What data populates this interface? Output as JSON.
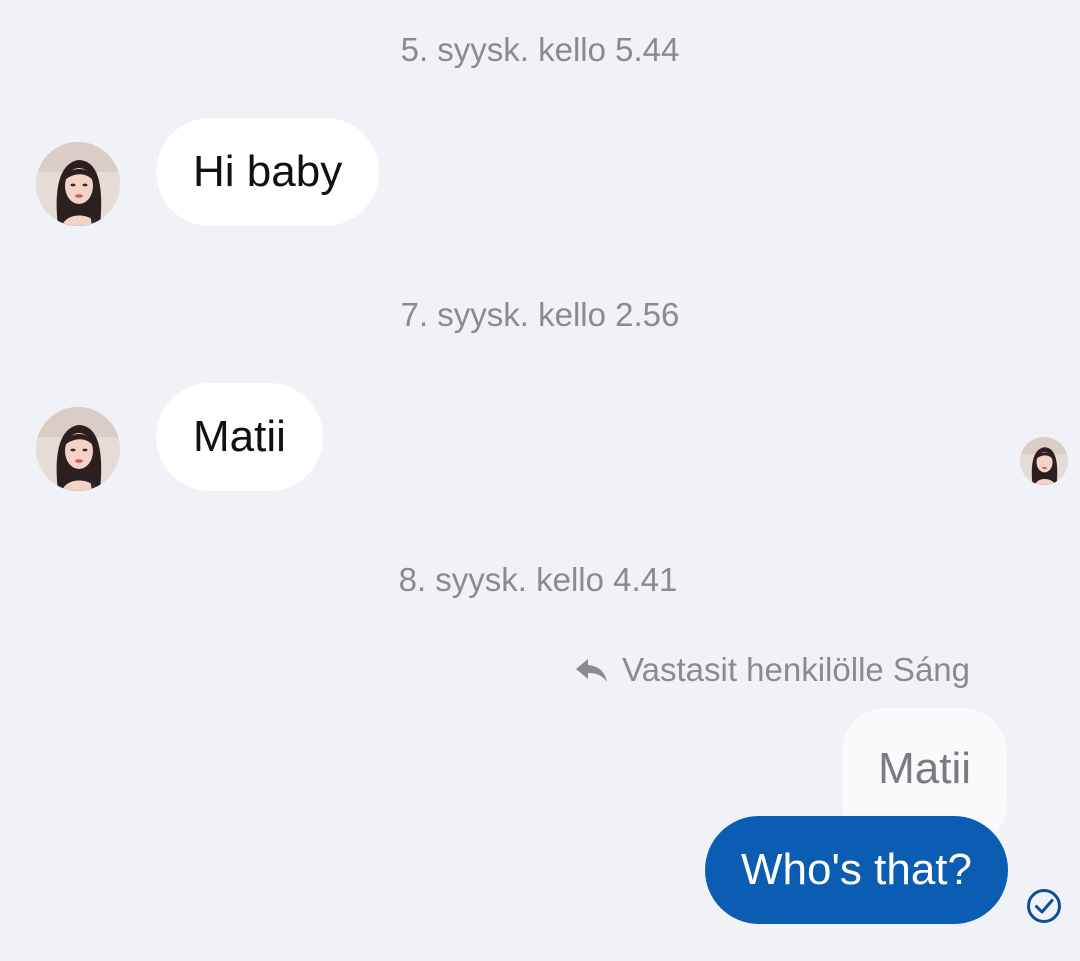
{
  "conversation": {
    "timestamps": [
      "5. syysk. kello 5.44",
      "7. syysk. kello 2.56",
      "8. syysk. kello 4.41"
    ],
    "incoming": [
      {
        "text": "Hi baby"
      },
      {
        "text": "Matii"
      }
    ],
    "reply": {
      "note": "Vastasit henkilölle Sáng",
      "quoted_text": "Matii",
      "text": "Who's that?"
    }
  },
  "icons": {
    "reply": "reply-arrow-icon",
    "read_receipt": "check-circle-icon",
    "avatar": "contact-photo"
  },
  "colors": {
    "background": "#f1f2f8",
    "outgoing_bubble": "#0a5db3",
    "incoming_bubble": "#ffffff",
    "timestamp_text": "#8a8b8f"
  }
}
